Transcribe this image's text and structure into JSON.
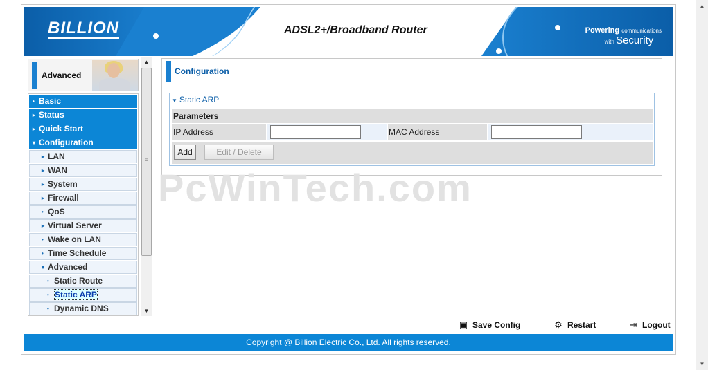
{
  "header": {
    "brand": "BILLION",
    "product_title": "ADSL2+/Broadband Router",
    "tagline_main": "Powering",
    "tagline_small": "communications",
    "tagline_with": "with",
    "tagline_big": "Security"
  },
  "sidebar": {
    "section_title": "Advanced",
    "items": [
      {
        "label": "Basic",
        "level": "top",
        "marker": "•"
      },
      {
        "label": "Status",
        "level": "top",
        "marker": "▸"
      },
      {
        "label": "Quick Start",
        "level": "top",
        "marker": "▸"
      },
      {
        "label": "Configuration",
        "level": "top",
        "marker": "▾"
      },
      {
        "label": "LAN",
        "level": "sub",
        "marker": "▸"
      },
      {
        "label": "WAN",
        "level": "sub",
        "marker": "▸"
      },
      {
        "label": "System",
        "level": "sub",
        "marker": "▸"
      },
      {
        "label": "Firewall",
        "level": "sub",
        "marker": "▸"
      },
      {
        "label": "QoS",
        "level": "sub",
        "marker": "•"
      },
      {
        "label": "Virtual Server",
        "level": "sub",
        "marker": "▸"
      },
      {
        "label": "Wake on LAN",
        "level": "sub",
        "marker": "•"
      },
      {
        "label": "Time Schedule",
        "level": "sub",
        "marker": "•"
      },
      {
        "label": "Advanced",
        "level": "sub",
        "marker": "▾"
      },
      {
        "label": "Static Route",
        "level": "sub2",
        "marker": "•"
      },
      {
        "label": "Static ARP",
        "level": "sub2",
        "marker": "•",
        "current": true
      },
      {
        "label": "Dynamic DNS",
        "level": "sub2",
        "marker": "•"
      }
    ]
  },
  "main": {
    "panel_title": "Configuration",
    "section_title": "Static ARP",
    "params_header": "Parameters",
    "ip_label": "IP Address",
    "ip_value": "",
    "mac_label": "MAC Address",
    "mac_value": "",
    "add_label": "Add",
    "edit_delete_label": "Edit / Delete"
  },
  "watermark": "PcWinTech.com",
  "actions": {
    "save": "Save Config",
    "restart": "Restart",
    "logout": "Logout"
  },
  "footer": {
    "copyright": "Copyright @ Billion Electric Co., Ltd. All rights reserved."
  },
  "colors": {
    "accent_blue": "#0c86d6",
    "dark_blue": "#0b5ea8",
    "panel_gray": "#dedede"
  }
}
